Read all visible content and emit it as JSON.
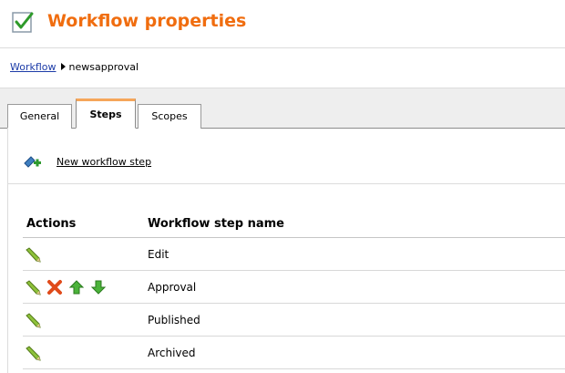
{
  "header": {
    "title": "Workflow properties",
    "icon": "checkmark-document-icon",
    "title_color": "#f06d0f"
  },
  "breadcrumb": {
    "parent_label": "Workflow",
    "current_label": "newsapproval"
  },
  "tabs": [
    {
      "label": "General",
      "active": false
    },
    {
      "label": "Steps",
      "active": true
    },
    {
      "label": "Scopes",
      "active": false
    }
  ],
  "toolbar": {
    "new_step_label": "New workflow step",
    "new_step_icon": "add-step-icon"
  },
  "table": {
    "headers": {
      "actions": "Actions",
      "name": "Workflow step name"
    },
    "rows": [
      {
        "name": "Edit",
        "actions": [
          "edit-icon"
        ]
      },
      {
        "name": "Approval",
        "actions": [
          "edit-icon",
          "delete-icon",
          "move-up-icon",
          "move-down-icon"
        ]
      },
      {
        "name": "Published",
        "actions": [
          "edit-icon"
        ]
      },
      {
        "name": "Archived",
        "actions": [
          "edit-icon"
        ]
      }
    ]
  }
}
